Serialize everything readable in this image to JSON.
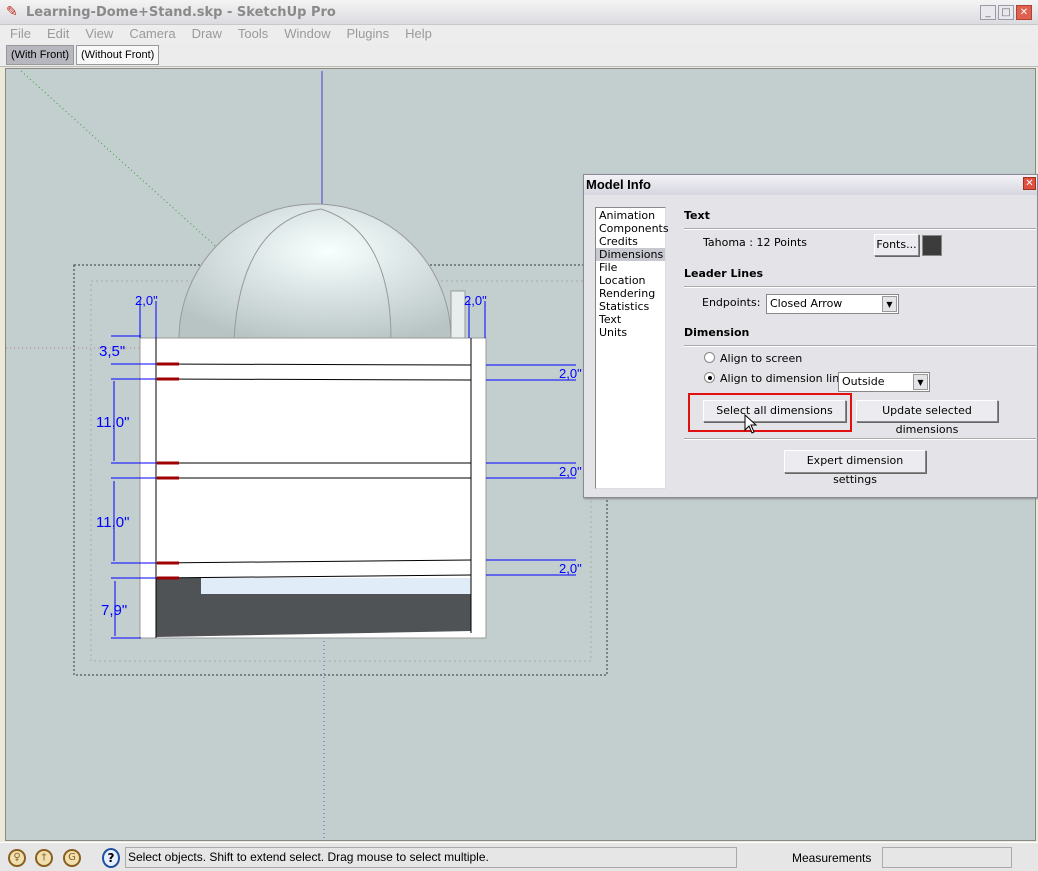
{
  "window": {
    "title": "Learning-Dome+Stand.skp - SketchUp Pro",
    "buttons": {
      "minimize": "_",
      "maximize": "□",
      "close": "✕"
    }
  },
  "menu": [
    "File",
    "Edit",
    "View",
    "Camera",
    "Draw",
    "Tools",
    "Window",
    "Plugins",
    "Help"
  ],
  "scene_tabs": [
    {
      "label": "(With Front)",
      "active": true
    },
    {
      "label": "(Without Front)",
      "active": false
    }
  ],
  "model": {
    "dimensions_left": [
      "3,5\"",
      "11,0\"",
      "11,0\"",
      "7,9\""
    ],
    "dimensions_top": [
      "2,0\"",
      "2,0\""
    ],
    "dimensions_right": [
      "2,0\"",
      "2,0\"",
      "2,0\""
    ],
    "colors": {
      "dimension": "#0000ff",
      "background": "#c3cfcf"
    }
  },
  "dialog": {
    "title": "Model Info",
    "categories": [
      "Animation",
      "Components",
      "Credits",
      "Dimensions",
      "File",
      "Location",
      "Rendering",
      "Statistics",
      "Text",
      "Units"
    ],
    "selected_category": "Dimensions",
    "text_section": {
      "heading": "Text",
      "font": "Tahoma : 12 Points",
      "fonts_button": "Fonts...",
      "color": "#3c3c3c"
    },
    "leader_section": {
      "heading": "Leader Lines",
      "endpoints_label": "Endpoints:",
      "endpoints_value": "Closed Arrow"
    },
    "dimension_section": {
      "heading": "Dimension",
      "align_screen": "Align to screen",
      "align_line": "Align to dimension line",
      "align_selected": "Align to dimension line",
      "position_value": "Outside",
      "select_all": "Select all dimensions",
      "update_selected": "Update selected dimensions",
      "expert": "Expert dimension settings"
    }
  },
  "annotation_color": "#e01010",
  "status": {
    "message": "Select objects. Shift to extend select. Drag mouse to select multiple.",
    "measurements_label": "Measurements",
    "measurements_value": ""
  }
}
